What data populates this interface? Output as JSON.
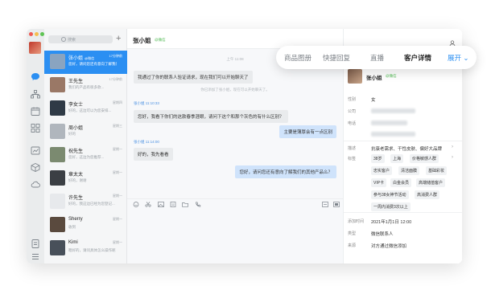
{
  "search": {
    "placeholder": "搜索",
    "add": "+"
  },
  "chats": [
    {
      "name": "张小姐",
      "tag": "@微信",
      "time": "17分钟前",
      "preview": "您好，请问您还有意向了解我们的...",
      "color": "#8aa4c0"
    },
    {
      "name": "王先生",
      "tag": "",
      "time": "17分钟前",
      "preview": "我们的产品有很多款...",
      "color": "#9a7866"
    },
    {
      "name": "李女士",
      "tag": "",
      "time": "星期四",
      "preview": "好的，这边可以为您安排...",
      "color": "#2f3a46"
    },
    {
      "name": "周小姐",
      "tag": "",
      "time": "星期三",
      "preview": "好的",
      "color": "#b0b6bd"
    },
    {
      "name": "祝先生",
      "tag": "",
      "time": "星期一",
      "preview": "您好，这边为您推荐...",
      "color": "#7b8a70"
    },
    {
      "name": "章太太",
      "tag": "",
      "time": "星期一",
      "preview": "好的，谢谢",
      "color": "#3b3f44"
    },
    {
      "name": "许先生",
      "tag": "",
      "time": "星期一",
      "preview": "好的，我这边已经为您登记...",
      "color": "#e7e9ec"
    },
    {
      "name": "Sherry",
      "tag": "",
      "time": "星期一",
      "preview": "收到",
      "color": "#5a4a3e"
    },
    {
      "name": "Kimi",
      "tag": "",
      "time": "星期一",
      "preview": "嗯好的，请问具体怎么操作呢",
      "color": "#48505a"
    }
  ],
  "chat": {
    "title": "张小姐",
    "tag": "@微信",
    "messages": [
      {
        "kind": "time",
        "text": "上午 11:08"
      },
      {
        "kind": "left",
        "text": "我通过了你的联系人验证请求，现在我们可以开始聊天了"
      },
      {
        "kind": "sys",
        "text": "你已添加了张小姐，现在可以开始聊天了。"
      },
      {
        "kind": "who",
        "text": "张小姐  11:10:33"
      },
      {
        "kind": "left",
        "text": "您好，我看下你们的这款春季涯眼，请问下这个和那个灰色的有什么区别？"
      },
      {
        "kind": "right",
        "text": "主要是薄厚会有一点区别"
      },
      {
        "kind": "who",
        "text": "张小姐  11:14:00"
      },
      {
        "kind": "left",
        "text": "好的，我先看看"
      },
      {
        "kind": "right",
        "text": "您好，请问您还有意向了解我们的其他产品么？"
      }
    ]
  },
  "tabs": {
    "items": [
      "商品图册",
      "快捷回复",
      "直播",
      "客户详情"
    ],
    "active": "客户详情",
    "more": "展开"
  },
  "detail": {
    "name": "张小姐",
    "tag": "@微信",
    "fields": {
      "gender_label": "性别",
      "gender": "女",
      "company_label": "公司",
      "phone_label": "电话",
      "desc_label": "描述",
      "desc": "抗衰老需求、干性皮肤、偏好大品牌",
      "tags_label": "标签",
      "added_label": "添加时间",
      "added": "2021年1月1日 12:00",
      "type_label": "类型",
      "type": "微信联系人",
      "source_label": "来源",
      "source": "对方通过微信添加"
    },
    "tags": [
      "38岁",
      "上海",
      "价格敏感人群",
      "忠实客户",
      "清洁面膜",
      "基础彩妆",
      "VIP卡",
      "白金会员",
      "高端储值客户",
      "参与38女神节活动",
      "高消费人群",
      "一周内消费3次以上"
    ]
  }
}
